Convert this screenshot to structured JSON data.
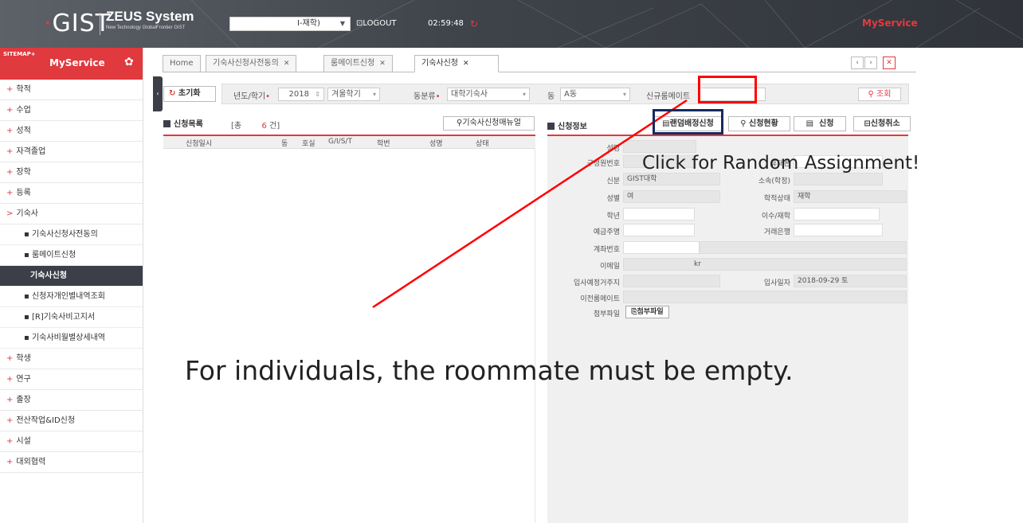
{
  "header": {
    "logo": "GIST",
    "brand_title": "ZEUS System",
    "brand_subtitle": "New Technology GlobalFrontier GIST",
    "department_value": "I-재학)",
    "logout_label": "LOGOUT",
    "session_timer": "02:59:48",
    "myservice_label": "MyService"
  },
  "sidebar": {
    "sitemap_label": "SITEMAP+",
    "title": "MyService",
    "items": [
      {
        "label": "학적"
      },
      {
        "label": "수업"
      },
      {
        "label": "성적"
      },
      {
        "label": "자격졸업"
      },
      {
        "label": "장학"
      },
      {
        "label": "등록"
      },
      {
        "label": "기숙사"
      }
    ],
    "sub_items": [
      {
        "label": "기숙사신청사전동의"
      },
      {
        "label": "룸메이트신청"
      },
      {
        "label": "기숙사신청"
      },
      {
        "label": "신청자개인별내역조회"
      },
      {
        "label": "[R]기숙사비고지서"
      },
      {
        "label": "기숙사비월별상세내역"
      }
    ],
    "items_after": [
      {
        "label": "학생"
      },
      {
        "label": "연구"
      },
      {
        "label": "출장"
      },
      {
        "label": "전산작업&ID신청"
      },
      {
        "label": "시설"
      },
      {
        "label": "대외협력"
      }
    ]
  },
  "tabs": [
    {
      "label": "Home"
    },
    {
      "label": "기숙사신청사전동의"
    },
    {
      "label": "룸메이트신청"
    },
    {
      "label": "기숙사신청"
    }
  ],
  "search": {
    "reset_label": "초기화",
    "year_term_label": "년도/학기",
    "year_value": "2018",
    "term_value": "겨울학기",
    "building_type_label": "동분류",
    "building_type_value": "대학기숙사",
    "building_label": "동",
    "building_value": "A동",
    "new_roommate_label": "신규룸메이트",
    "new_roommate_value": "",
    "search_label": "조회"
  },
  "list_panel": {
    "title": "신청목록",
    "count_prefix": "[총",
    "count_value": "6",
    "count_suffix": "건]",
    "manual_button": "기숙사신청매뉴얼",
    "columns": [
      "신청일시",
      "동",
      "호실",
      "G/I/S/T",
      "학번",
      "성명",
      "상태"
    ]
  },
  "form_panel": {
    "title": "신청정보",
    "buttons": {
      "random": "랜덤배정신청",
      "status": "신청현황",
      "apply": "신청",
      "cancel": "신청취소"
    },
    "fields": {
      "name_label": "성명",
      "id_label": "구성원번호",
      "phone_label": "휴대폰",
      "status_label": "신분",
      "status_value": "GIST대학",
      "dept_label": "소속(학정)",
      "gender_label": "성별",
      "gender_value": "여",
      "academic_label": "학적상태",
      "academic_value": "재학",
      "grade_label": "학년",
      "complete_label": "이수/재학",
      "account_holder_label": "예금주명",
      "bank_label": "거래은행",
      "account_label": "계좌번호",
      "email_label": "이메일",
      "email_value": "kr",
      "address_label": "입사예정거주지",
      "move_in_label": "입사일자",
      "move_in_value": "2018-09-29 토",
      "prev_roommate_label": "이전룸메이트",
      "attach_label": "첨부파일",
      "attach_button": "첨부파일"
    }
  },
  "annotations": {
    "random_caption": "Click for Random Assignment!",
    "individual_caption": "For individuals, the roommate must be empty.",
    "highlight_color": "#ff0000",
    "box_color": "#152a5e"
  }
}
